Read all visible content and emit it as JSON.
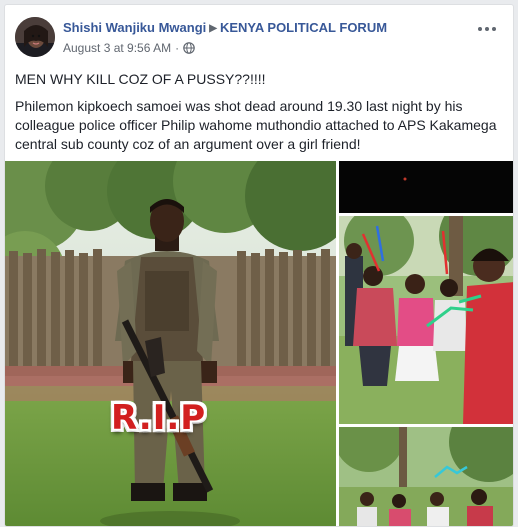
{
  "post": {
    "author": "Shishi Wanjiku Mwangi",
    "group": "KENYA POLITICAL FORUM",
    "timestamp": "August 3 at 9:56 AM",
    "privacy_icon": "globe-icon",
    "headline": "MEN WHY KILL COZ OF A PUSSY??!!!!",
    "body": "Philemon kipkoech samoei was shot dead around 19.30 last night by his colleague police officer Philip wahome muthondio attached to APS Kakamega central sub county coz of an argument over a girl friend!"
  },
  "photos": {
    "main_overlay_text": "R.I.P"
  },
  "colors": {
    "link_blue": "#385898",
    "text": "#1d2129",
    "meta_gray": "#616770",
    "rip_red": "#d21f1f"
  }
}
